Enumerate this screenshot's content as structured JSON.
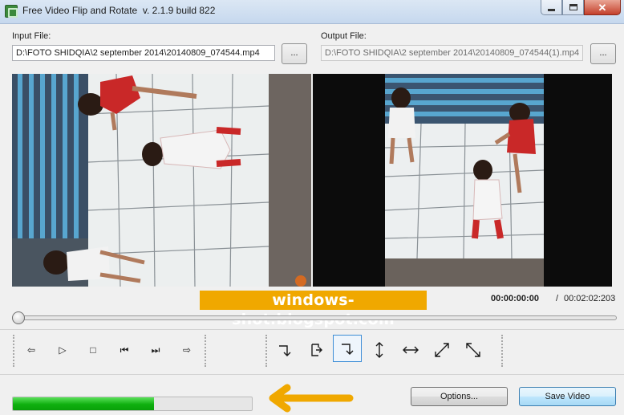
{
  "window": {
    "title": "Free Video Flip and Rotate  v. 2.1.9 build 822",
    "min_icon": "minimize-icon",
    "max_icon": "maximize-icon",
    "close_icon": "close-icon",
    "close_glyph": "✕"
  },
  "input": {
    "label": "Input File:",
    "value": "D:\\FOTO SHIDQIA\\2 september 2014\\20140809_074544.mp4",
    "browse_label": "..."
  },
  "output": {
    "label": "Output File:",
    "value": "D:\\FOTO SHIDQIA\\2 september 2014\\20140809_074544(1).mp4",
    "browse_label": "..."
  },
  "watermark": "windows-shot.blogspot.com",
  "time": {
    "current": "00:00:00:00",
    "separator": "/",
    "total": "00:02:02:203"
  },
  "seek": {
    "position": 0
  },
  "playback": [
    {
      "name": "seek-back-icon",
      "glyph": "⇦"
    },
    {
      "name": "play-icon",
      "glyph": "▷"
    },
    {
      "name": "stop-icon",
      "glyph": "□"
    },
    {
      "name": "previous-frame-icon",
      "glyph": "⏮"
    },
    {
      "name": "next-frame-icon",
      "glyph": "⏭"
    },
    {
      "name": "seek-forward-icon",
      "glyph": "⇨"
    }
  ],
  "transforms": [
    {
      "name": "rotate-left-icon",
      "selected": false
    },
    {
      "name": "rotate-180-icon",
      "selected": false
    },
    {
      "name": "rotate-right-icon",
      "selected": true
    },
    {
      "name": "flip-vertical-icon",
      "selected": false
    },
    {
      "name": "flip-horizontal-icon",
      "selected": false
    },
    {
      "name": "transpose-icon",
      "selected": false
    },
    {
      "name": "transverse-icon",
      "selected": false
    }
  ],
  "progress": {
    "fraction": 0.59
  },
  "buttons": {
    "options": "Options...",
    "save": "Save Video"
  },
  "colors": {
    "watermark_bg": "#f0a800",
    "annotation_arrow": "#f0a800",
    "progress_green": "#0fb00f",
    "selected_outline": "#3d8dd6"
  }
}
